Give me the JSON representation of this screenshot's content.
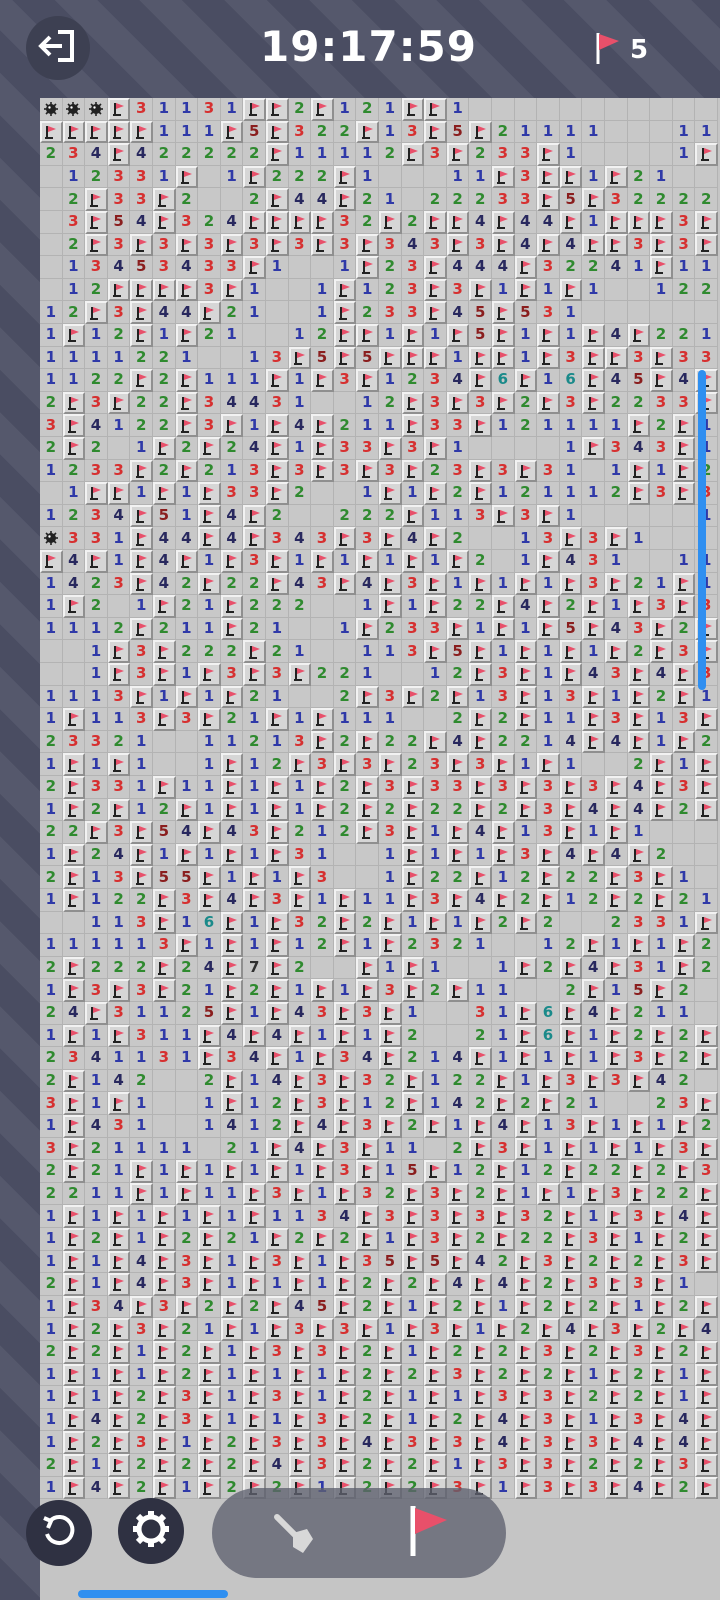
{
  "header": {
    "timer": "19:17:59",
    "flag_count": "5"
  },
  "icons": {
    "exit": "exit-door-icon",
    "flag": "flag-icon",
    "mine": "mine-icon",
    "undo": "undo-icon",
    "settings": "gear-icon",
    "dig": "shovel-icon"
  },
  "colors": {
    "number_1": "#2f39a8",
    "number_2": "#2f8a2f",
    "number_3": "#d63030",
    "number_4": "#28285e",
    "number_5": "#8a1e1e",
    "number_6": "#1a8a8a",
    "number_7": "#303030",
    "flag_red": "#e8506a"
  },
  "board": {
    "columns": 30,
    "rows": [
      "MMMF31131FF2F121FF1",
      "FFFFF111F5F322F13F5F21111   111",
      "234F422222F11112F3F233F1    1F1",
      " 12331F 1F222F1   11F3FF1F21  223",
      " 2F33F2  2F44F21 22233F5F322222F2",
      " 3F54F324FFFF32F2FF4F44F1FFF3F2",
      " 2F3F3F3F3F3F3F343F3F4F4FF3F3FF3FF5F32F22",
      " 13453433F1  1F23F444F32241F1122F1",
      " 12FFFF3F1  1F123F3F1F1F1  1221 1F2F1",
      "12F3F44F21  1F233F45F531       1F3",
      "1F12F1F21  12FF1F1F5F1F1F4F221   2FF",
      "1111221  13F5F5FFF1FF1F3FF3F333F3F2",
      "1122F2F111F1F3F1234F6F16F45F4F3F1F3F1",
      "2F3F22F34431  12F3F3F2F3F2233F3F4F3",
      "3F4122F3F1F4F211F33F121111F2F11F1F23",
      "2F2 1F2F24F1F33F3F1    1F343F1   11",
      "1233F2F213F3F3F3F23F3F31 1F1F2F1F111F3",
      " 1FF1F1F33F2  1F1F2F121112F3F3F1F3",
      "1234F51F4F2  222F113F3F1     111  2F",
      "M331F44F4F343F3F4F2  13F3F1        124",
      "F4F1F4F1F3F1F1F1F1F2 1F431  111  1F2",
      "1423F42F22F43F4F3F1F1F1F3F21F12F2232",
      "1F2 1F21F222  1F1F22F4F2F1F3F3F5F1F1 1",
      "1112F211F21  1F233F1F1F5F43F2F3F1F1F5F33",
      "  1F3F222F21  113F5F1F1F1F2F3F2F1F5F31",
      "  1F3F1F3F3F221  12F3F1F43F4F3F21223F1F222",
      "1113F1F1F21  2F3F2F13F13F1F2F1F2F21  12",
      "1F113F3F21F1F111  2F2F11F3F13F3F3F4F22 1F3",
      "23321  11213F2F22F4F2214F4F1F2F22233F3",
      "1F1F1  1F12F3F3F23F3F1F1  2F1F4F23F1F3F1",
      "2F331F11F1F1F2F3F33F3F3F3F4F3F3F1F111F2F23F3",
      "1F2F12F1F1F1F2F2F22F2F3F4F4F2F1  11F1111F2",
      "22F3F54F43F212F3F1F4F13F1F1         2",
      "1F24F1F1F1F31  1F1F1F3F4F4F2   1F12F124",
      "2F13F55F1F1F3  1F22F12F22F3F1  1F3F12F13",
      "1F122F3F4F3F1F11F3F4F2F12F2F21  23F3F3F24",
      "  113F16F1F32F2F1F1F2F2  2331F131F4F12F13",
      "111113F1F1F12F1F2321  12F1F1F2F1F1F3F1F123",
      "2F222F24F7F2  F1F1  1F2F4F31F2F31  11 12",
      "1F3F3F21F2F1F1F3F2F11  2F15F2  111",
      "24F31125F1F43F3F1  31F6F4F211",
      "1F1F311F4F4F1F1F2  21F6F1F2F2F211111111",
      "2341131F34F1F34F214F1F1F1F3F2F3F1F2F21F22F2",
      "2F142  2F14F3F32F122F1F3F3F42  23F1F23F4",
      "3F1F1  1F12F3F12F142F2F21  23F12F4F35F1",
      "1F431  1412F4F3F2F1F4F13F1F1F2F1F24F1F3F1F1F1F4",
      "3F21111 21F4F3F11 2F3F1F1F1F3F1F1F3F3F3F4F2",
      "2F21F1F1F1F1F3F15F12F12F22F2F3F1F2F1F1F23F2F111",
      "2211F1F11F3F1F32F3F2F1F1F3F22F2F3F22F21F2F1F2",
      "1F1F1F1F1F1134F3F3F3F32F1F3F4F1F3F4F4F2F22F1F11",
      "1F2F1F2F21F2F2F1F3F2F22F3F1F2F2F1F3F3F1F1F3F31F2F2",
      "1F1F4F3F1F3F1F35F5F42F3F2F2F3F2F3F2F2F2F1F2F2F1F1F1F1F1F1F2",
      "2F1F4F3F1F1F1F2F2F4F4F2F3F3F1  1111  1F3F2",
      "1F34F3F2F2F45F2F1F2F1F2F2F1F2F1F2   1F3F3F2",
      "1F2F3F21F1F3F3F1F3F1F2F4F3F2F4F4F1F2F1F2F1F1    3F5",
      "2F2F1F2F1F3F3F2F1F2F2F3F2F3F2F2F2F2F3F1F2F1F3F3F2F1F3",
      "1F1F1F2F1F1F1F2F2F3F2F2F1F2F1F2F1F2F1F2F1F2F1F1F3F1",
      "1F1F2F3F1F3F1F2F1F1F3F3F2F2F1F2F3F2F3F3F2F1F2F3",
      "1F4F2F3F1F1F3F2F1F2F4F3F1F3F4F3F2F2F1F3F2F2F1F2F1",
      "1F2F3F1F2F3F3F4F3F3F4F3F3F4F4F2F4F3F2F2F2F2F1F2F3",
      "2F1F2F2F2F4F3F2F2F1F3F3F2F2F3F2F1F3F1F2F3F4F1F2F1",
      "1F4F2F1F2F2F1F2F2F3F1F3F3F4F2F1F2F2F1F3F1F2F1F1"
    ]
  }
}
